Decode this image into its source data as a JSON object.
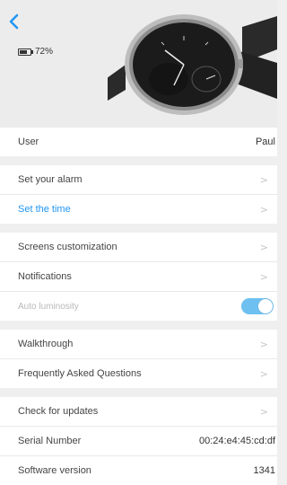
{
  "header": {
    "battery_percent": "72%",
    "battery_level": 0.72,
    "accent_color": "#2196f3"
  },
  "sections": {
    "user": {
      "label": "User",
      "value": "Paul"
    },
    "alarm": {
      "label": "Set your alarm"
    },
    "time": {
      "label": "Set the time"
    },
    "screens": {
      "label": "Screens customization"
    },
    "notifications": {
      "label": "Notifications"
    },
    "luminosity": {
      "label": "Auto luminosity",
      "enabled": true
    },
    "walkthrough": {
      "label": "Walkthrough"
    },
    "faq": {
      "label": "Frequently Asked Questions"
    },
    "updates": {
      "label": "Check for updates"
    },
    "serial": {
      "label": "Serial Number",
      "value": "00:24:e4:45:cd:df"
    },
    "software": {
      "label": "Software version",
      "value": "1341"
    }
  }
}
